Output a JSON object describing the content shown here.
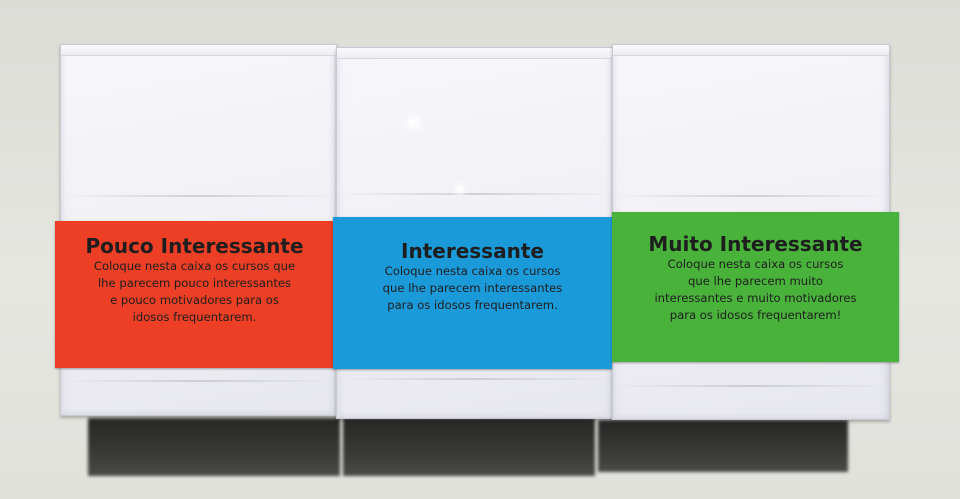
{
  "labels": [
    {
      "title": "Pouco Interessante",
      "lines": [
        "Coloque nesta caixa os cursos que",
        "lhe parecem pouco interessantes",
        "e pouco motivadores para os",
        "idosos frequentarem."
      ],
      "color": "#ec3f25"
    },
    {
      "title": "Interessante",
      "lines": [
        "Coloque nesta caixa os cursos",
        "que lhe parecem interessantes",
        "para os idosos frequentarem."
      ],
      "color": "#1b9ad9"
    },
    {
      "title": "Muito Interessante",
      "lines": [
        "Coloque nesta caixa os cursos",
        "que lhe parecem muito",
        "interessantes e muito motivadores",
        "para os idosos frequentarem!"
      ],
      "color": "#49b23a"
    }
  ],
  "colors": {
    "box_paper": "#f3f3f7",
    "wall": "#e1e1dc",
    "shadow": "#2f2f2d"
  }
}
